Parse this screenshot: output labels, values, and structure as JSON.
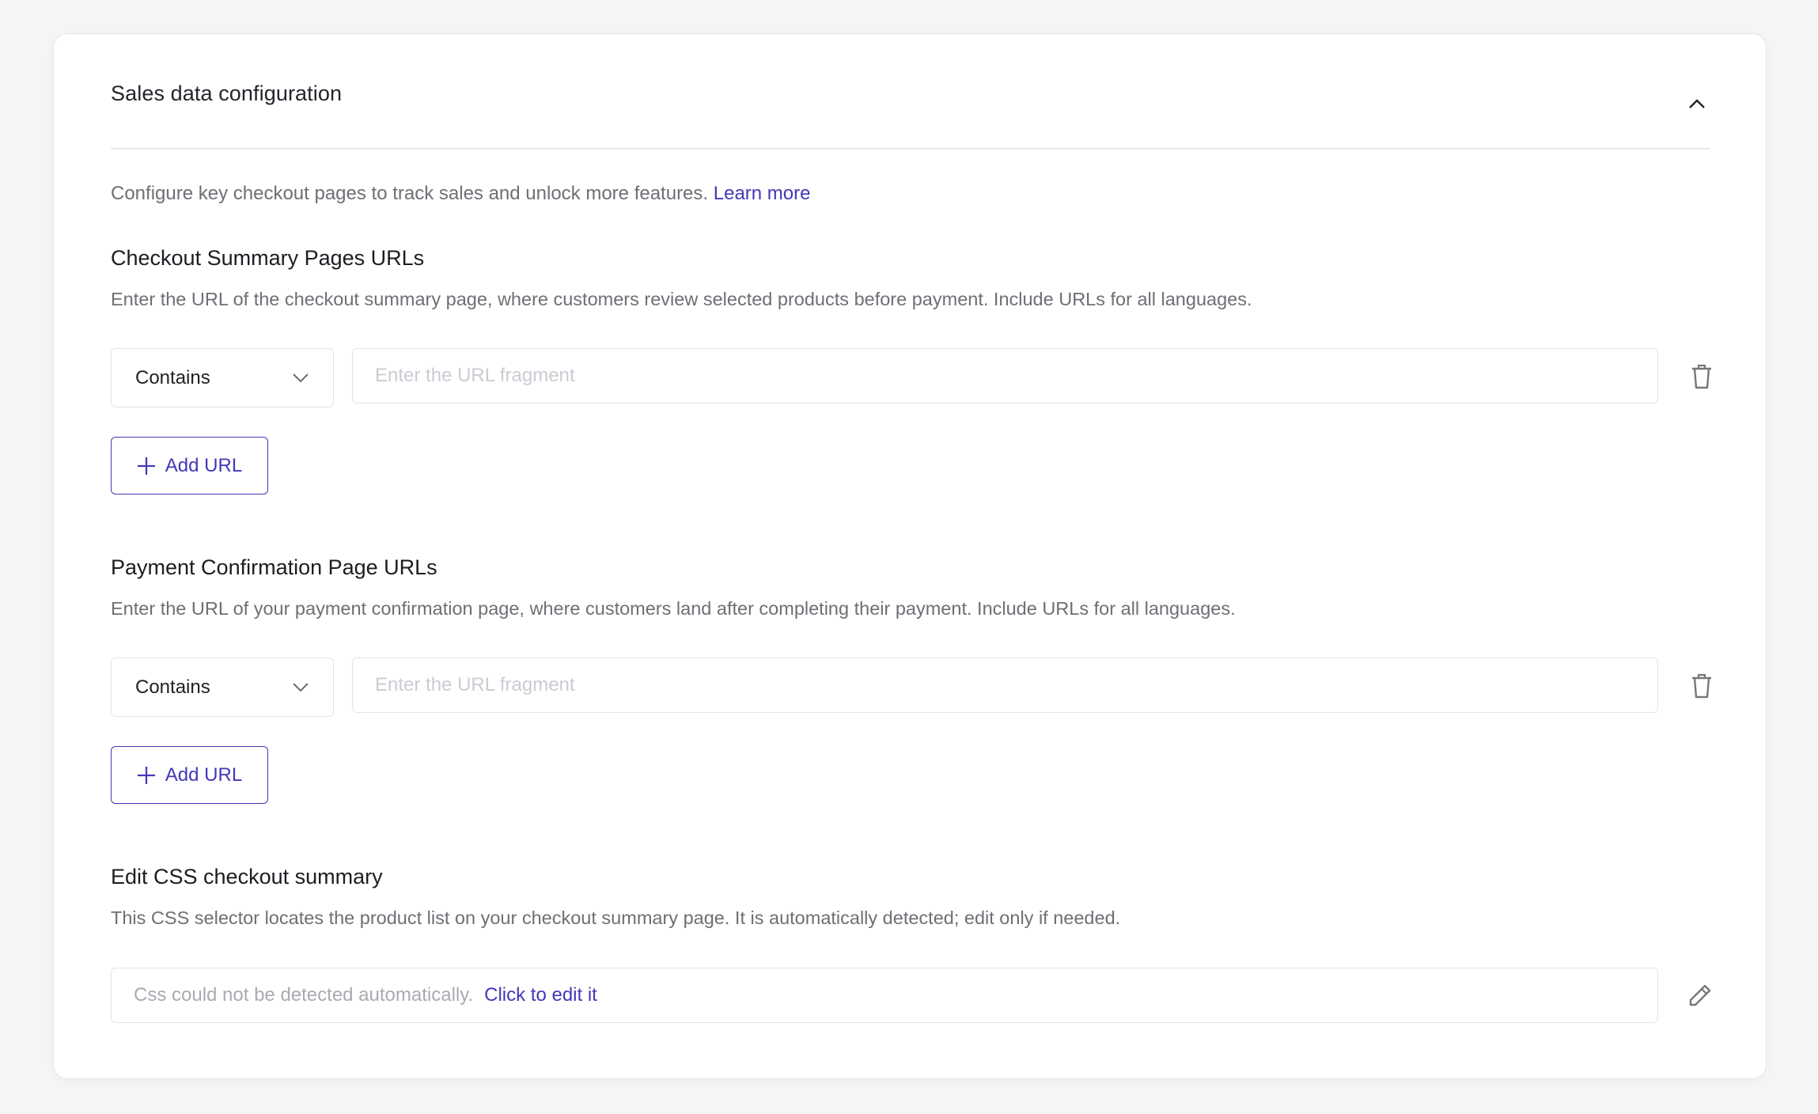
{
  "card": {
    "title": "Sales data configuration",
    "collapse_icon": "chevron-up-icon",
    "intro_text": "Configure key checkout pages to track sales and unlock more features.",
    "learn_more_label": "Learn more"
  },
  "checkout_summary": {
    "heading": "Checkout Summary Pages URLs",
    "description": "Enter the URL of the checkout summary page, where customers review selected products before payment. Include URLs for all languages.",
    "rules": [
      {
        "match_type": "Contains",
        "value": "",
        "placeholder": "Enter the URL fragment"
      }
    ],
    "add_button_label": "Add URL"
  },
  "payment_confirmation": {
    "heading": "Payment Confirmation Page URLs",
    "description": "Enter the URL of your payment confirmation page, where customers land after completing their payment. Include URLs for all languages.",
    "rules": [
      {
        "match_type": "Contains",
        "value": "",
        "placeholder": "Enter the URL fragment"
      }
    ],
    "add_button_label": "Add URL"
  },
  "css_checkout": {
    "heading": "Edit CSS checkout summary",
    "description": "This CSS selector locates the product list on your checkout summary page. It is automatically detected; edit only if needed.",
    "status_text": "Css could not be detected automatically.",
    "edit_link_label": "Click to edit it"
  },
  "colors": {
    "accent": "#4338b8",
    "page_background": "#f6f6f8",
    "muted_text": "#6e6f75",
    "border": "#e4e4e8"
  }
}
